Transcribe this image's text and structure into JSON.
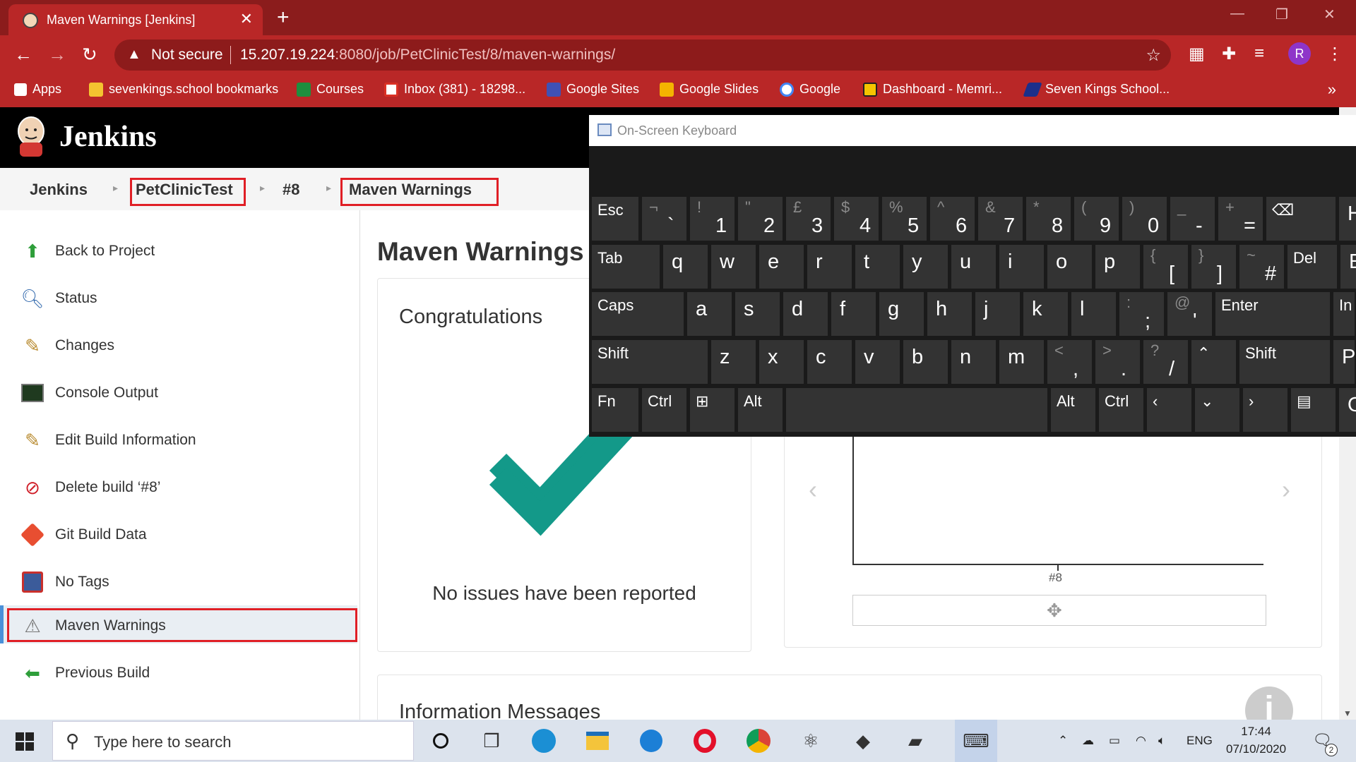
{
  "browser": {
    "tab_title": "Maven Warnings [Jenkins]",
    "new_tab": "+",
    "not_secure": "Not secure",
    "url_host": "15.207.19.224",
    "url_path": ":8080/job/PetClinicTest/8/maven-warnings/",
    "profile_initial": "R",
    "bookmarks": [
      "Apps",
      "sevenkings.school bookmarks",
      "Courses",
      "Inbox (381) - 18298...",
      "Google Sites",
      "Google Slides",
      "Google",
      "Dashboard - Memri...",
      "Seven Kings School..."
    ],
    "more": "»",
    "colors": {
      "frame": "#8b1c1c",
      "toolbar": "#b92727"
    }
  },
  "jenkins": {
    "title": "Jenkins",
    "breadcrumbs": [
      "Jenkins",
      "PetClinicTest",
      "#8",
      "Maven Warnings"
    ],
    "sidebar": [
      {
        "label": "Back to Project",
        "icon": "up-arrow-icon"
      },
      {
        "label": "Status",
        "icon": "magnifier-icon"
      },
      {
        "label": "Changes",
        "icon": "notepad-icon"
      },
      {
        "label": "Console Output",
        "icon": "terminal-icon"
      },
      {
        "label": "Edit Build Information",
        "icon": "notepad-icon"
      },
      {
        "label": "Delete build ‘#8’",
        "icon": "no-entry-icon"
      },
      {
        "label": "Git Build Data",
        "icon": "git-icon"
      },
      {
        "label": "No Tags",
        "icon": "floppy-icon"
      },
      {
        "label": "Maven Warnings",
        "icon": "warning-icon"
      },
      {
        "label": "Previous Build",
        "icon": "left-arrow-icon"
      }
    ],
    "page_title": "Maven Warnings",
    "card_title": "Congratulations",
    "no_issues": "No issues have been reported",
    "chart_tick": "#8",
    "info_title": "Information Messages",
    "colors": {
      "check": "#139989",
      "highlight": "#e01f26"
    }
  },
  "osk": {
    "title": "On-Screen Keyboard",
    "rows": [
      [
        {
          "t": "",
          "m": "Esc",
          "w": 66
        },
        {
          "t": "¬",
          "m": "`"
        },
        {
          "t": "!",
          "m": "1"
        },
        {
          "t": "\"",
          "m": "2"
        },
        {
          "t": "£",
          "m": "3"
        },
        {
          "t": "$",
          "m": "4"
        },
        {
          "t": "%",
          "m": "5"
        },
        {
          "t": "^",
          "m": "6"
        },
        {
          "t": "&",
          "m": "7"
        },
        {
          "t": "*",
          "m": "8"
        },
        {
          "t": "(",
          "m": "9"
        },
        {
          "t": ")",
          "m": "0"
        },
        {
          "t": "_",
          "m": "-"
        },
        {
          "t": "+",
          "m": "="
        },
        {
          "t": "",
          "m": "⌫",
          "w": 98
        },
        {
          "t": "",
          "m": "H",
          "w": 30
        }
      ],
      [
        {
          "t": "",
          "m": "Tab",
          "w": 96
        },
        {
          "m": "q"
        },
        {
          "m": "w"
        },
        {
          "m": "e"
        },
        {
          "m": "r"
        },
        {
          "m": "t"
        },
        {
          "m": "y"
        },
        {
          "m": "u"
        },
        {
          "m": "i"
        },
        {
          "m": "o"
        },
        {
          "m": "p"
        },
        {
          "t": "{",
          "m": "["
        },
        {
          "t": "}",
          "m": "]"
        },
        {
          "t": "~",
          "m": "#"
        },
        {
          "t": "",
          "m": "Del",
          "w": 70
        },
        {
          "t": "",
          "m": "E",
          "w": 30
        }
      ],
      [
        {
          "t": "",
          "m": "Caps",
          "w": 130
        },
        {
          "m": "a"
        },
        {
          "m": "s"
        },
        {
          "m": "d"
        },
        {
          "m": "f"
        },
        {
          "m": "g"
        },
        {
          "m": "h"
        },
        {
          "m": "j"
        },
        {
          "m": "k"
        },
        {
          "m": "l"
        },
        {
          "t": ":",
          "m": ";"
        },
        {
          "t": "@",
          "m": "'"
        },
        {
          "t": "",
          "m": "Enter",
          "w": 162
        },
        {
          "t": "",
          "m": "In",
          "w": 30
        }
      ],
      [
        {
          "t": "",
          "m": "Shift",
          "w": 164
        },
        {
          "m": "z"
        },
        {
          "m": "x"
        },
        {
          "m": "c"
        },
        {
          "m": "v"
        },
        {
          "m": "b"
        },
        {
          "m": "n"
        },
        {
          "m": "m"
        },
        {
          "t": "<",
          "m": ","
        },
        {
          "t": ">",
          "m": "."
        },
        {
          "t": "?",
          "m": "/"
        },
        {
          "t": "",
          "m": "⌃"
        },
        {
          "t": "",
          "m": "Shift",
          "w": 128
        },
        {
          "t": "",
          "m": "P",
          "w": 30
        }
      ],
      [
        {
          "t": "",
          "m": "Fn",
          "w": 66
        },
        {
          "t": "",
          "m": "Ctrl"
        },
        {
          "t": "",
          "m": "⊞"
        },
        {
          "t": "",
          "m": "Alt"
        },
        {
          "t": "",
          "m": "",
          "w": 370
        },
        {
          "t": "",
          "m": "Alt"
        },
        {
          "t": "",
          "m": "Ctrl"
        },
        {
          "t": "",
          "m": "‹"
        },
        {
          "t": "",
          "m": "⌄"
        },
        {
          "t": "",
          "m": "›"
        },
        {
          "t": "",
          "m": "▤"
        },
        {
          "t": "",
          "m": "O",
          "w": 30
        }
      ]
    ]
  },
  "taskbar": {
    "search_placeholder": "Type here to search",
    "lang": "ENG",
    "time": "17:44",
    "date": "07/10/2020",
    "notifications": "2"
  }
}
